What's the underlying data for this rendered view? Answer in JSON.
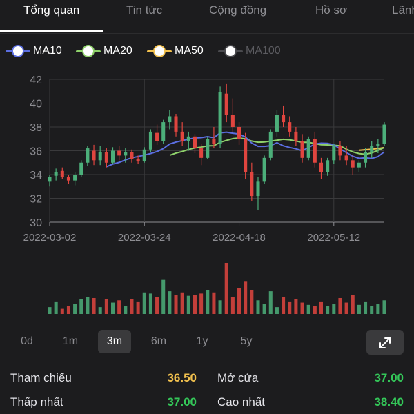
{
  "tabs": [
    {
      "label": "Tổng quan",
      "active": true
    },
    {
      "label": "Tin tức",
      "active": false
    },
    {
      "label": "Cộng đồng",
      "active": false
    },
    {
      "label": "Hồ sơ",
      "active": false
    },
    {
      "label": "Lãnh",
      "active": false
    }
  ],
  "legend": [
    {
      "label": "MA10",
      "color": "#5b6ee1",
      "enabled": true
    },
    {
      "label": "MA20",
      "color": "#8fd16b",
      "enabled": true
    },
    {
      "label": "MA50",
      "color": "#f2c14e",
      "enabled": true
    },
    {
      "label": "MA100",
      "color": "#5b5b60",
      "enabled": false
    }
  ],
  "colors": {
    "up": "#4caf7a",
    "down": "#e0453f",
    "grid": "#3a3a3c",
    "axis_text": "#8e8e93",
    "yellow": "#f2c14e",
    "green": "#34c759"
  },
  "chart_data": {
    "type": "candlestick",
    "y_ticks": [
      30,
      32,
      34,
      36,
      38,
      40,
      42
    ],
    "ylim": [
      30,
      42
    ],
    "x_ticks": [
      "2022-03-02",
      "2022-03-24",
      "2022-04-18",
      "2022-05-12"
    ],
    "x_tick_index": [
      0,
      15,
      30,
      45
    ],
    "candles": [
      {
        "o": 33.4,
        "h": 34.0,
        "l": 33.0,
        "c": 33.8
      },
      {
        "o": 33.9,
        "h": 34.5,
        "l": 33.5,
        "c": 34.2
      },
      {
        "o": 34.3,
        "h": 34.6,
        "l": 33.6,
        "c": 33.8
      },
      {
        "o": 33.8,
        "h": 34.0,
        "l": 33.2,
        "c": 33.5
      },
      {
        "o": 33.5,
        "h": 34.2,
        "l": 33.1,
        "c": 34.0
      },
      {
        "o": 34.0,
        "h": 35.2,
        "l": 33.8,
        "c": 35.0
      },
      {
        "o": 35.0,
        "h": 36.4,
        "l": 34.7,
        "c": 36.2
      },
      {
        "o": 36.0,
        "h": 36.5,
        "l": 34.8,
        "c": 35.2
      },
      {
        "o": 35.2,
        "h": 36.4,
        "l": 34.8,
        "c": 35.9
      },
      {
        "o": 35.9,
        "h": 36.2,
        "l": 34.6,
        "c": 35.0
      },
      {
        "o": 35.0,
        "h": 36.3,
        "l": 34.9,
        "c": 36.0
      },
      {
        "o": 36.0,
        "h": 36.4,
        "l": 35.2,
        "c": 35.6
      },
      {
        "o": 35.6,
        "h": 36.2,
        "l": 35.0,
        "c": 35.9
      },
      {
        "o": 35.9,
        "h": 36.1,
        "l": 35.0,
        "c": 35.3
      },
      {
        "o": 35.3,
        "h": 35.6,
        "l": 34.9,
        "c": 35.1
      },
      {
        "o": 35.1,
        "h": 36.3,
        "l": 35.0,
        "c": 36.1
      },
      {
        "o": 36.1,
        "h": 37.8,
        "l": 35.9,
        "c": 37.6
      },
      {
        "o": 37.5,
        "h": 38.2,
        "l": 36.5,
        "c": 36.8
      },
      {
        "o": 36.8,
        "h": 38.6,
        "l": 36.6,
        "c": 38.4
      },
      {
        "o": 38.4,
        "h": 39.4,
        "l": 37.8,
        "c": 38.9
      },
      {
        "o": 38.9,
        "h": 39.1,
        "l": 37.2,
        "c": 37.6
      },
      {
        "o": 37.6,
        "h": 38.4,
        "l": 36.4,
        "c": 36.8
      },
      {
        "o": 36.8,
        "h": 37.6,
        "l": 36.0,
        "c": 37.2
      },
      {
        "o": 37.2,
        "h": 37.4,
        "l": 35.8,
        "c": 36.2
      },
      {
        "o": 36.2,
        "h": 36.6,
        "l": 34.8,
        "c": 35.4
      },
      {
        "o": 35.4,
        "h": 37.2,
        "l": 35.3,
        "c": 37.0
      },
      {
        "o": 37.0,
        "h": 38.0,
        "l": 36.2,
        "c": 36.6
      },
      {
        "o": 36.6,
        "h": 41.4,
        "l": 36.2,
        "c": 40.9
      },
      {
        "o": 40.8,
        "h": 41.6,
        "l": 38.4,
        "c": 39.0
      },
      {
        "o": 39.0,
        "h": 40.4,
        "l": 37.6,
        "c": 38.0
      },
      {
        "o": 38.0,
        "h": 38.4,
        "l": 36.5,
        "c": 37.0
      },
      {
        "o": 37.0,
        "h": 37.5,
        "l": 33.6,
        "c": 34.2
      },
      {
        "o": 34.2,
        "h": 35.0,
        "l": 31.8,
        "c": 32.2
      },
      {
        "o": 32.2,
        "h": 33.8,
        "l": 31.0,
        "c": 33.4
      },
      {
        "o": 33.4,
        "h": 35.6,
        "l": 33.2,
        "c": 35.4
      },
      {
        "o": 35.4,
        "h": 37.8,
        "l": 35.2,
        "c": 37.6
      },
      {
        "o": 37.6,
        "h": 39.4,
        "l": 37.2,
        "c": 39.0
      },
      {
        "o": 39.0,
        "h": 39.8,
        "l": 38.0,
        "c": 38.4
      },
      {
        "o": 38.4,
        "h": 38.9,
        "l": 37.2,
        "c": 37.6
      },
      {
        "o": 37.6,
        "h": 38.0,
        "l": 36.4,
        "c": 36.8
      },
      {
        "o": 36.8,
        "h": 37.4,
        "l": 35.0,
        "c": 35.4
      },
      {
        "o": 35.4,
        "h": 37.2,
        "l": 35.2,
        "c": 37.0
      },
      {
        "o": 37.0,
        "h": 37.6,
        "l": 34.6,
        "c": 35.0
      },
      {
        "o": 35.0,
        "h": 35.4,
        "l": 33.6,
        "c": 34.2
      },
      {
        "o": 34.2,
        "h": 35.4,
        "l": 33.9,
        "c": 35.2
      },
      {
        "o": 35.2,
        "h": 36.6,
        "l": 34.9,
        "c": 36.4
      },
      {
        "o": 36.4,
        "h": 36.8,
        "l": 35.2,
        "c": 35.6
      },
      {
        "o": 35.6,
        "h": 36.4,
        "l": 34.8,
        "c": 35.2
      },
      {
        "o": 35.2,
        "h": 35.6,
        "l": 34.0,
        "c": 34.6
      },
      {
        "o": 34.6,
        "h": 35.2,
        "l": 34.2,
        "c": 35.0
      },
      {
        "o": 35.0,
        "h": 36.2,
        "l": 34.6,
        "c": 35.9
      },
      {
        "o": 35.9,
        "h": 36.8,
        "l": 35.4,
        "c": 36.4
      },
      {
        "o": 36.4,
        "h": 37.0,
        "l": 35.8,
        "c": 36.6
      },
      {
        "o": 36.6,
        "h": 38.4,
        "l": 36.4,
        "c": 38.2
      }
    ],
    "volumes": [
      12,
      22,
      9,
      14,
      18,
      26,
      30,
      28,
      12,
      26,
      20,
      24,
      14,
      26,
      22,
      38,
      36,
      30,
      60,
      40,
      34,
      38,
      32,
      34,
      36,
      42,
      38,
      24,
      90,
      30,
      46,
      58,
      42,
      24,
      18,
      40,
      12,
      30,
      22,
      26,
      20,
      16,
      14,
      22,
      14,
      18,
      28,
      20,
      34,
      16,
      22,
      14,
      18,
      24
    ],
    "ma10_from": 9,
    "ma20_from": 19,
    "ma50_from": 49
  },
  "ranges": [
    {
      "label": "0d",
      "active": false
    },
    {
      "label": "1m",
      "active": false
    },
    {
      "label": "3m",
      "active": true
    },
    {
      "label": "6m",
      "active": false
    },
    {
      "label": "1y",
      "active": false
    },
    {
      "label": "5y",
      "active": false
    }
  ],
  "expand_icon": "expand-arrows-icon",
  "stats": {
    "reference": {
      "label": "Tham chiếu",
      "value": "36.50"
    },
    "open": {
      "label": "Mở cửa",
      "value": "37.00"
    },
    "low": {
      "label": "Thấp nhất",
      "value": "37.00"
    },
    "high": {
      "label": "Cao nhất",
      "value": "38.40"
    }
  }
}
